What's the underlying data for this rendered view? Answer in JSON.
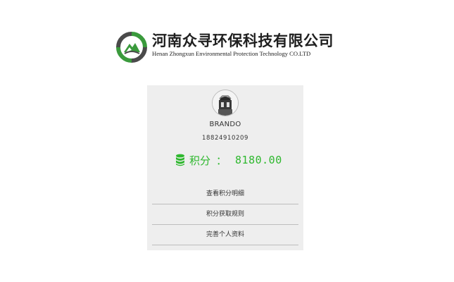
{
  "header": {
    "company_name": "河南众寻环保科技有限公司",
    "company_name_en": "Henan Zhongxun Environmental Protection Technology CO.LTD",
    "logo_icon": "leaf-ring-logo-icon"
  },
  "profile": {
    "avatar_icon": "user-avatar-icon",
    "name": "BRANDO",
    "phone": "18824910209"
  },
  "points": {
    "icon": "coin-stack-icon",
    "label": "积分",
    "colon": "：",
    "value": "8180.00",
    "color": "#2eb82e"
  },
  "menu": {
    "items": [
      {
        "label": "查看积分明细"
      },
      {
        "label": "积分获取规则"
      },
      {
        "label": "完善个人资料"
      }
    ]
  },
  "colors": {
    "logo_green": "#3a9a3c",
    "logo_dark": "#4a4a4a",
    "card_bg": "#eeeeee",
    "accent": "#2eb82e"
  }
}
